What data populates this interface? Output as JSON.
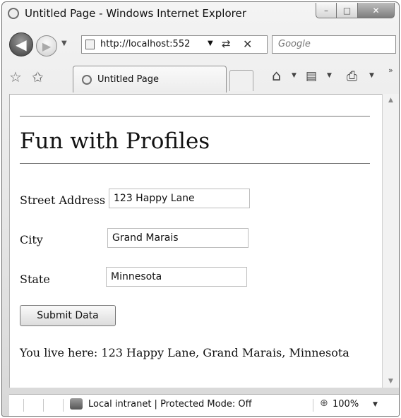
{
  "window": {
    "title": "Untitled Page - Windows Internet Explorer",
    "controls": {
      "minimize": "–",
      "maximize": "□",
      "close": "✕"
    }
  },
  "navigation": {
    "address": "http://localhost:552",
    "search_placeholder": "Google"
  },
  "tabs": [
    {
      "label": "Untitled Page"
    }
  ],
  "page": {
    "title": "Fun with Profiles",
    "fields": [
      {
        "label": "Street Address",
        "value": "123 Happy Lane"
      },
      {
        "label": "City",
        "value": "Grand Marais"
      },
      {
        "label": "State",
        "value": "Minnesota"
      }
    ],
    "submit_label": "Submit Data",
    "result": "You live here: 123 Happy Lane, Grand Marais, Minnesota"
  },
  "statusbar": {
    "zone": "Local intranet | Protected Mode: Off",
    "zoom": "100%"
  },
  "icons": {
    "back": "back-arrow-icon",
    "forward": "forward-arrow-icon",
    "refresh": "refresh-icon",
    "stop": "stop-icon",
    "favorites": "favorites-star-icon",
    "add_favorites": "add-favorites-icon",
    "home": "home-icon",
    "feeds": "feeds-icon",
    "print": "print-icon",
    "zoom": "zoom-icon"
  }
}
